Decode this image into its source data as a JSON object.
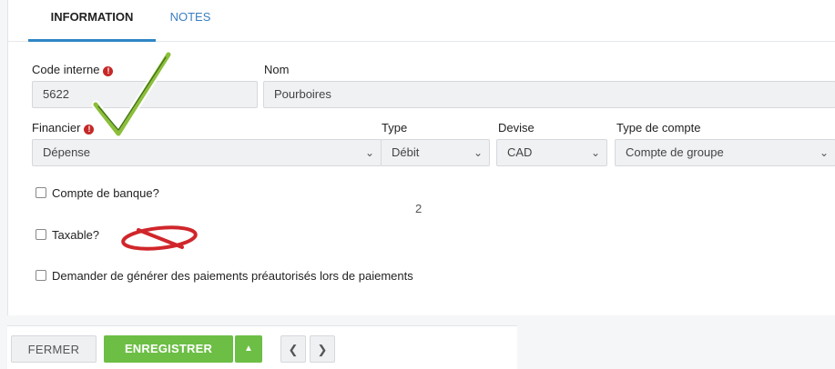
{
  "tabs": [
    {
      "label": "INFORMATION",
      "active": true
    },
    {
      "label": "NOTES",
      "active": false
    }
  ],
  "form": {
    "code": {
      "label": "Code interne",
      "value": "5622",
      "required": true
    },
    "nom": {
      "label": "Nom",
      "value": "Pourboires"
    },
    "financier": {
      "label": "Financier",
      "value": "Dépense",
      "required": true
    },
    "type": {
      "label": "Type",
      "value": "Débit"
    },
    "devise": {
      "label": "Devise",
      "value": "CAD"
    },
    "type_compte": {
      "label": "Type de compte",
      "value": "Compte de groupe"
    },
    "checkboxes": [
      {
        "label": "Compte de banque?",
        "checked": false
      },
      {
        "label": "Taxable?",
        "checked": false
      },
      {
        "label": "Demander de générer des paiements préautorisés lors de paiements",
        "checked": false
      }
    ],
    "page_number": "2"
  },
  "footer": {
    "close_label": "FERMER",
    "save_label": "ENREGISTRER"
  },
  "colors": {
    "accent_blue": "#2f86c5",
    "save_green": "#6cbe45",
    "required_red": "#c62828",
    "annotation_check": "#8bbf3a",
    "annotation_no": "#d0262b"
  },
  "icons": {
    "required": "exclamation-circle-icon",
    "select": "chevron-down-icon",
    "caret": "caret-up-icon",
    "prev": "chevron-left-icon",
    "next": "chevron-right-icon"
  }
}
